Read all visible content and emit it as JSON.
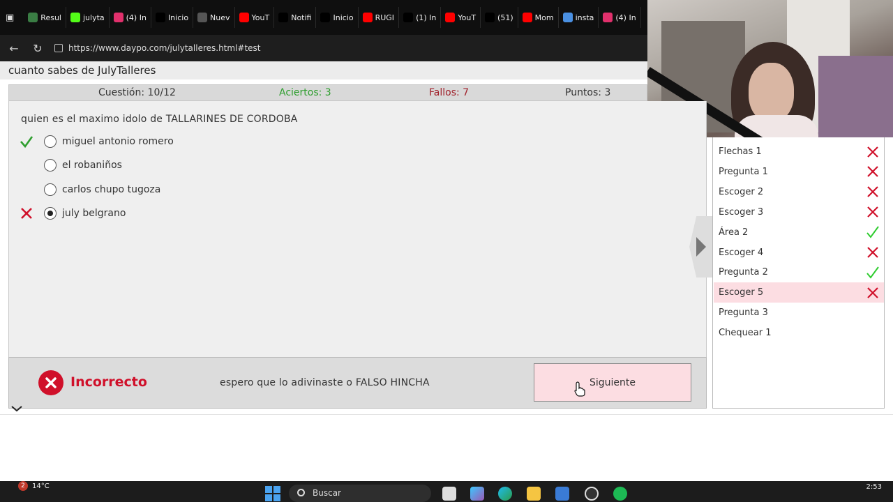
{
  "browser": {
    "tabs": [
      {
        "label": "Resul",
        "icon": "chrome-green-icon",
        "color": "#3a7d44"
      },
      {
        "label": "julyta",
        "icon": "k-logo-icon",
        "color": "#53fc18"
      },
      {
        "label": "(4) In",
        "icon": "instagram-icon",
        "color": "#e1306c"
      },
      {
        "label": "Inicio",
        "icon": "x-logo-icon",
        "color": "#000000"
      },
      {
        "label": "Nuev",
        "icon": "document-icon",
        "color": "#555555"
      },
      {
        "label": "YouT",
        "icon": "youtube-icon",
        "color": "#ff0000"
      },
      {
        "label": "Notifi",
        "icon": "x-logo-icon",
        "color": "#000000"
      },
      {
        "label": "Inicio",
        "icon": "x-logo-icon",
        "color": "#000000"
      },
      {
        "label": "RUGI",
        "icon": "youtube-icon",
        "color": "#ff0000"
      },
      {
        "label": "(1) In",
        "icon": "x-logo-icon",
        "color": "#000000"
      },
      {
        "label": "YouT",
        "icon": "youtube-icon",
        "color": "#ff0000"
      },
      {
        "label": "(51)",
        "icon": "tiktok-icon",
        "color": "#000000"
      },
      {
        "label": "Mom",
        "icon": "youtube-icon",
        "color": "#ff0000"
      },
      {
        "label": "insta",
        "icon": "search-icon",
        "color": "#4a90e2"
      },
      {
        "label": "(4) In",
        "icon": "instagram-icon",
        "color": "#e1306c"
      }
    ],
    "url": "https://www.daypo.com/julytalleres.html#test"
  },
  "page": {
    "title": "cuanto sabes de JulyTalleres"
  },
  "stats": {
    "question": "Cuestión: 10/12",
    "correct": "Aciertos: 3",
    "wrong": "Fallos: 7",
    "points": "Puntos: 3"
  },
  "quiz": {
    "question": "quien es el maximo idolo de TALLARINES DE CORDOBA",
    "options": [
      {
        "text": "miguel antonio romero",
        "mark": "check",
        "selected": false
      },
      {
        "text": "el robaniños",
        "mark": "",
        "selected": false
      },
      {
        "text": "carlos chupo tugoza",
        "mark": "",
        "selected": false
      },
      {
        "text": "july belgrano",
        "mark": "cross",
        "selected": true
      }
    ]
  },
  "feedback": {
    "label": "Incorrecto",
    "message": "espero que lo adivinaste o FALSO HINCHA",
    "next_label": "Siguiente"
  },
  "sidebar": {
    "items": [
      {
        "label": "Flechas 1",
        "status": "wrong"
      },
      {
        "label": "Pregunta 1",
        "status": "wrong"
      },
      {
        "label": "Escoger 2",
        "status": "wrong"
      },
      {
        "label": "Escoger 3",
        "status": "wrong"
      },
      {
        "label": "Área 2",
        "status": "right"
      },
      {
        "label": "Escoger 4",
        "status": "wrong"
      },
      {
        "label": "Pregunta 2",
        "status": "right"
      },
      {
        "label": "Escoger 5",
        "status": "wrong",
        "active": true
      },
      {
        "label": "Pregunta 3",
        "status": ""
      },
      {
        "label": "Chequear 1",
        "status": ""
      }
    ]
  },
  "taskbar": {
    "notification_count": "2",
    "temperature": "14°C",
    "search_placeholder": "Buscar",
    "time": "2:53"
  },
  "colors": {
    "correct": "#2e9e2e",
    "wrong": "#d0102a",
    "accent_pink": "#fcdde2",
    "stat_correct": "#2e9e2e",
    "stat_wrong": "#a0202a"
  }
}
